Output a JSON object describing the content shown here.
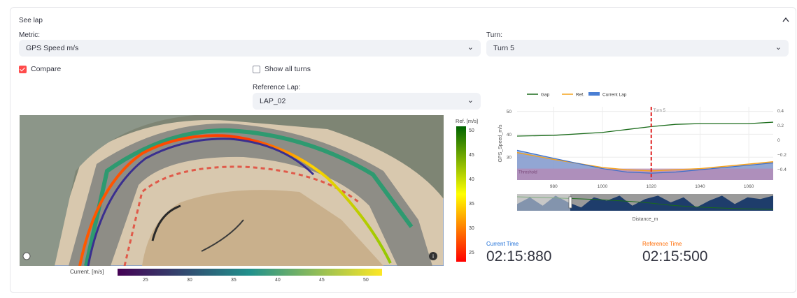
{
  "expander": {
    "title": "See lap",
    "collapse_icon": "chevron-up-icon"
  },
  "metric": {
    "label": "Metric:",
    "value": "GPS Speed m/s"
  },
  "turn": {
    "label": "Turn:",
    "value": "Turn 5"
  },
  "compare": {
    "label": "Compare",
    "checked": true
  },
  "show_all_turns": {
    "label": "Show all turns",
    "checked": false
  },
  "reference_lap": {
    "label": "Reference Lap:",
    "value": "LAP_02"
  },
  "map": {
    "ref_colorbar": {
      "title": "Ref. [m/s]",
      "ticks": [
        "50",
        "45",
        "40",
        "35",
        "30",
        "25"
      ],
      "colors": [
        "#006400",
        "#ffff00",
        "#ff0000"
      ]
    },
    "current_colorbar": {
      "title": "Current. [m/s]",
      "ticks": [
        "25",
        "30",
        "35",
        "40",
        "45",
        "50"
      ],
      "colors": [
        "#440154",
        "#21918c",
        "#fde725"
      ]
    },
    "ref_line_color": "#ff6a00",
    "current_line_color": "#3a2f8f"
  },
  "chart_data": {
    "type": "line",
    "legend": [
      {
        "name": "Gap",
        "color": "#1a6b1a"
      },
      {
        "name": "Ref.",
        "color": "#f4a21c"
      },
      {
        "name": "Current Lap",
        "color": "#4a7fd4"
      }
    ],
    "xlabel": "Distance_m",
    "ylabel": "GPS_Speed_m/s",
    "xlim": [
      965,
      1070
    ],
    "ylim": [
      20,
      52
    ],
    "y2lim": [
      -0.55,
      0.45
    ],
    "x_ticks": [
      "980",
      "1000",
      "1020",
      "1040",
      "1060"
    ],
    "y_ticks": [
      "50",
      "40",
      "30"
    ],
    "y2_ticks": [
      "0.4",
      "0.2",
      "0",
      "−0.2",
      "−0.4"
    ],
    "turn_marker": {
      "x": 1020,
      "label": "Turn 5"
    },
    "threshold": {
      "y": 25,
      "label": "Threshold"
    },
    "series": [
      {
        "name": "Gap",
        "axis": "y2",
        "x": [
          965,
          980,
          1000,
          1010,
          1020,
          1030,
          1040,
          1050,
          1060,
          1070
        ],
        "values": [
          0.05,
          0.06,
          0.1,
          0.14,
          0.18,
          0.21,
          0.22,
          0.22,
          0.22,
          0.24
        ]
      },
      {
        "name": "Ref.",
        "axis": "y",
        "x": [
          965,
          980,
          1000,
          1010,
          1020,
          1030,
          1040,
          1050,
          1060,
          1070
        ],
        "values": [
          32,
          29,
          25.5,
          24.5,
          24,
          24.5,
          25,
          26,
          27,
          28
        ]
      },
      {
        "name": "Current Lap",
        "axis": "y",
        "x": [
          965,
          980,
          1000,
          1010,
          1020,
          1030,
          1040,
          1050,
          1060,
          1070
        ],
        "values": [
          33,
          29.5,
          25,
          23.5,
          23,
          23.5,
          24.5,
          25.5,
          26.5,
          27.5
        ]
      }
    ]
  },
  "minimap": {
    "ref_color": "#1e3d6b",
    "gap_color": "#1a6b1a"
  },
  "current_time": {
    "label": "Current Time",
    "value": "02:15:880",
    "color": "#1c6ed8"
  },
  "reference_time": {
    "label": "Reference Time",
    "value": "02:15:500",
    "color": "#ff6a00"
  }
}
